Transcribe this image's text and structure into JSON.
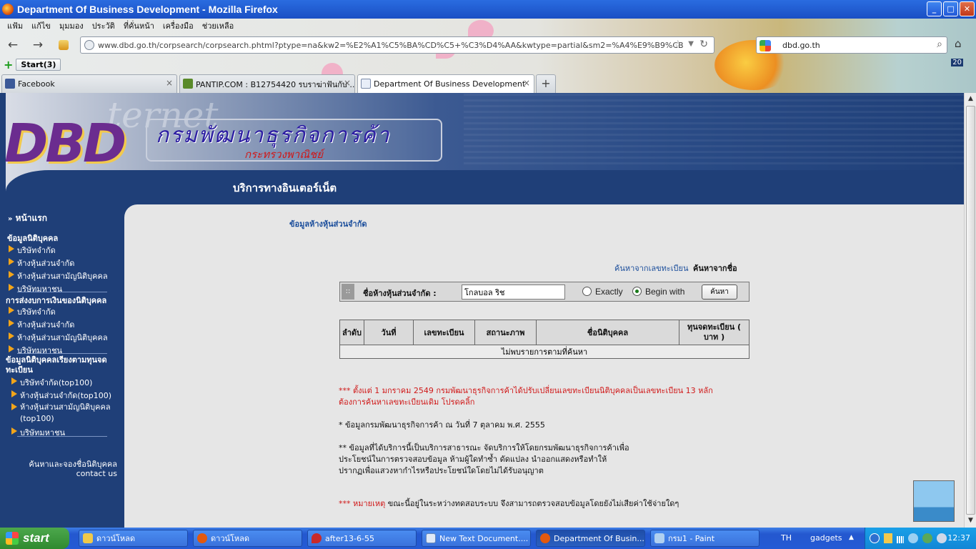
{
  "window": {
    "title": "Department Of Business Development - Mozilla Firefox",
    "min": "_",
    "max": "□",
    "close": "✕"
  },
  "menu": [
    "แฟ้ม",
    "แก้ไข",
    "มุมมอง",
    "ประวัติ",
    "ที่คั่นหน้า",
    "เครื่องมือ",
    "ช่วยเหลือ"
  ],
  "nav": {
    "back": "←",
    "forward": "→",
    "url": "www.dbd.go.th/corpsearch/corpsearch.phtml?ptype=na&kw2=%E2%A1%C5%BA%CD%C5+%C3%D4%AA&kwtype=partial&sm2=%A4%E9%B9%CB%D2&ctype=",
    "star": "☆",
    "drop": "▼",
    "reload": "↻",
    "search_value": "dbd.go.th",
    "search_icon": "⌕",
    "home": "⌂"
  },
  "bookmarks": {
    "add": "+",
    "start": "Start(3)",
    "badge": "20"
  },
  "tabs": [
    {
      "label": "Facebook",
      "color": "#3b5998"
    },
    {
      "label": "PANTIP.COM : B12754420 รบราฆ่าฟันกับ ...",
      "color": "#5a8a2a"
    },
    {
      "label": "Department Of Business Development",
      "color": "#e8eef8"
    }
  ],
  "newtab": "+",
  "tab_close": "×",
  "banner": {
    "logo": "DBD",
    "ghost": "ternet",
    "title": "กรมพัฒนาธุรกิจการค้า",
    "subtitle": "กระทรวงพาณิชย์",
    "service": "บริการทางอินเตอร์เน็ต"
  },
  "sidebar": {
    "home": "หน้าแรก",
    "sections": [
      {
        "title": "ข้อมูลนิติบุคคล",
        "items": [
          "บริษัทจำกัด",
          "ห้างหุ้นส่วนจำกัด",
          "ห้างหุ้นส่วนสามัญนิติบุคคล",
          "บริษัทมหาชน"
        ]
      },
      {
        "title": "การส่งงบการเงินของนิติบุคคล",
        "items": [
          "บริษัทจำกัด",
          "ห้างหุ้นส่วนจำกัด",
          "ห้างหุ้นส่วนสามัญนิติบุคคล",
          "บริษัทมหาชน"
        ]
      },
      {
        "title": "ข้อมูลนิติบุคคลเรียงตามทุนจดทะเบียน",
        "items": [
          "บริษัทจำกัด(top100)",
          "ห้างหุ้นส่วนจำกัด(top100)",
          "ห้างหุ้นส่วนสามัญนิติบุคคล (top100)",
          "บริษัทมหาชน"
        ]
      }
    ],
    "link1": "ค้นหาและจองชื่อนิติบุคคล",
    "link2": "contact us"
  },
  "content": {
    "heading": "ข้อมูลห้างหุ้นส่วนจำกัด",
    "search_by_reg": "ค้นหาจากเลขทะเบียน",
    "search_by_name": "ค้นหาจากชื่อ",
    "handle": "::",
    "field_label": "ชื่อห้างหุ้นส่วนจำกัด :",
    "field_value": "โกลบอล ริช",
    "exactly": "Exactly",
    "begin_with": "Begin with",
    "search_button": "ค้นหา",
    "table": {
      "headers": [
        "ลำดับ",
        "วันที่",
        "เลขทะเบียน",
        "สถานะภาพ",
        "ชื่อนิติบุคคล",
        "ทุนจดทะเบียน ( บาท )"
      ],
      "empty": "ไม่พบรายการตามที่ค้นหา"
    },
    "note1_line1": "*** ตั้งแต่ 1 มกราคม 2549 กรมพัฒนาธุรกิจการค้าได้ปรับเปลี่ยนเลขทะเบียนนิติบุคคลเป็นเลขทะเบียน 13 หลัก",
    "note1_line2": "ต้องการค้นหาเลขทะเบียนเดิม โปรดคลิ้ก",
    "note2": "* ข้อมูลกรมพัฒนาธุรกิจการค้า ณ วันที่ 7 ตุลาคม พ.ศ. 2555",
    "note3_line1": "** ข้อมูลที่ได้บริการนี้เป็นบริการสาธารณะ จัดบริการให้โดยกรมพัฒนาธุรกิจการค้าเพื่อ",
    "note3_line2": "ประโยชน์ในการตรวจสอบข้อมูล ห้ามผู้ใดทำซ้ำ ดัดแปลง นำออกแสดงหรือทำให้",
    "note3_line3": "ปรากฏเพื่อแสวงหากำไรหรือประโยชน์ใดโดยไม่ได้รับอนุญาต",
    "note4_red": "*** หมายเหตุ",
    "note4_rest": " ขณะนี้อยู่ในระหว่างทดสอบระบบ จึงสามารถตรวจสอบข้อมูลโดยยังไม่เสียค่าใช้จ่ายใดๆ"
  },
  "taskbar": {
    "start": "start",
    "items": [
      {
        "label": "ดาวน์โหลด",
        "color": "#f0c94a"
      },
      {
        "label": "ดาวน์โหลด",
        "color": "#e2590e"
      },
      {
        "label": "after13-6-55",
        "color": "#c92a2a"
      },
      {
        "label": "New Text Document....",
        "color": "#dfe9f7"
      },
      {
        "label": "Department Of Busin...",
        "color": "#e2590e"
      },
      {
        "label": "กรม1 - Paint",
        "color": "#b0d0f0"
      }
    ],
    "lang": "TH",
    "gadgets": "gadgets",
    "gadgets_arrow": "▲",
    "clock": "12:37"
  }
}
